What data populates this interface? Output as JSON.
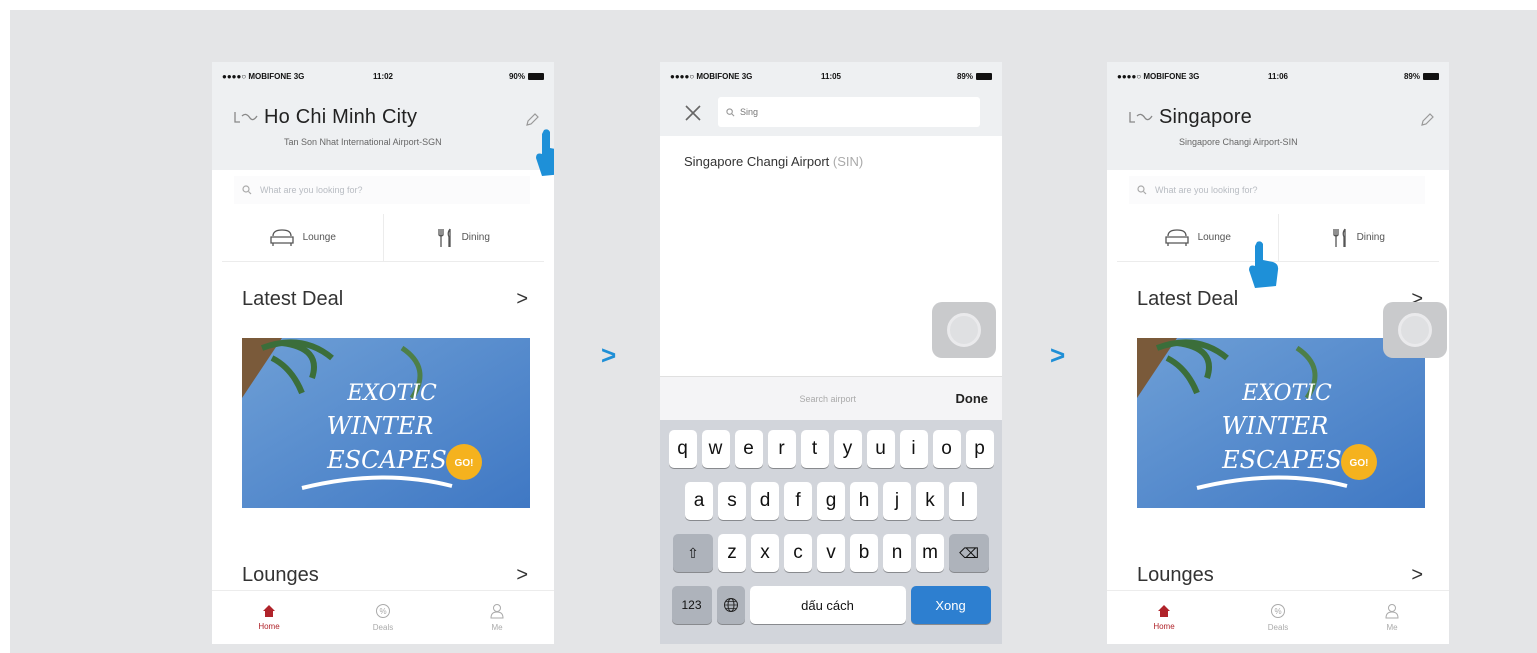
{
  "screens": [
    {
      "status": {
        "carrier": "●●●●○ MOBIFONE  3G",
        "time": "11:02",
        "battery": "90%"
      },
      "city": "Ho Chi Minh City",
      "airport": "Tan Son Nhat International Airport-SGN",
      "search_placeholder": "What are you looking for?",
      "categories": [
        "Lounge",
        "Dining"
      ],
      "latest_deal": {
        "title": "Latest Deal",
        "chevron": ">"
      },
      "banner": {
        "line1": "EXOTIC",
        "line2": "WINTER",
        "line3": "ESCAPES",
        "badge": "GO!"
      },
      "lounges": {
        "title": "Lounges",
        "chevron": ">"
      },
      "tabs": [
        "Home",
        "Deals",
        "Me"
      ]
    },
    {
      "status": {
        "carrier": "●●●●○ MOBIFONE  3G",
        "time": "11:05",
        "battery": "89%"
      },
      "search_value": "Sing",
      "result": {
        "name": "Singapore Changi Airport",
        "code": "(SIN)"
      },
      "keyboard_placeholder": "Search airport",
      "done_label": "Done",
      "keys": {
        "row1": [
          "q",
          "w",
          "e",
          "r",
          "t",
          "y",
          "u",
          "i",
          "o",
          "p"
        ],
        "row2": [
          "a",
          "s",
          "d",
          "f",
          "g",
          "h",
          "j",
          "k",
          "l"
        ],
        "row3": [
          "z",
          "x",
          "c",
          "v",
          "b",
          "n",
          "m"
        ],
        "numbers": "123",
        "space": "dấu cách",
        "go": "Xong"
      }
    },
    {
      "status": {
        "carrier": "●●●●○ MOBIFONE  3G",
        "time": "11:06",
        "battery": "89%"
      },
      "city": "Singapore",
      "airport": "Singapore Changi Airport-SIN",
      "search_placeholder": "What are you looking for?",
      "categories": [
        "Lounge",
        "Dining"
      ],
      "latest_deal": {
        "title": "Latest Deal",
        "chevron": ">"
      },
      "banner": {
        "line1": "EXOTIC",
        "line2": "WINTER",
        "line3": "ESCAPES",
        "badge": "GO!"
      },
      "lounges": {
        "title": "Lounges",
        "chevron": ">"
      },
      "tabs": [
        "Home",
        "Deals",
        "Me"
      ]
    }
  ],
  "flow_arrows": [
    ">",
    ">"
  ],
  "colors": {
    "accent_red": "#b0232a",
    "arrow_blue": "#1f8fd6",
    "keyboard_go": "#2d7fd0",
    "pointer_blue": "#1e90d8"
  }
}
